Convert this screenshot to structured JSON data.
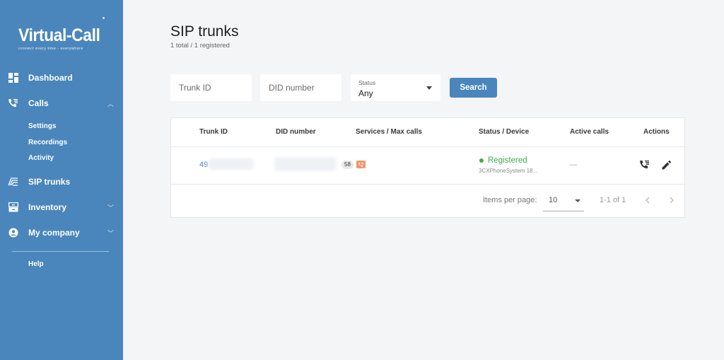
{
  "brand": {
    "name": "Virtual-Call",
    "tagline": "connect every time - everywhere"
  },
  "sidebar": {
    "items": [
      {
        "label": "Dashboard",
        "icon": "dashboard-icon"
      },
      {
        "label": "Calls",
        "icon": "phone-list-icon",
        "expanded": true,
        "children": [
          {
            "label": "Settings"
          },
          {
            "label": "Recordings"
          },
          {
            "label": "Activity"
          }
        ]
      },
      {
        "label": "SIP trunks",
        "icon": "sip-trunk-icon"
      },
      {
        "label": "Inventory",
        "icon": "inventory-icon"
      },
      {
        "label": "My company",
        "icon": "account-circle-icon"
      },
      {
        "label": "Help"
      }
    ]
  },
  "page": {
    "title": "SIP trunks",
    "subtitle": "1 total / 1 registered"
  },
  "filters": {
    "trunk_id_placeholder": "Trunk ID",
    "did_placeholder": "DID number",
    "status_label": "Status",
    "status_value": "Any",
    "search_label": "Search"
  },
  "table": {
    "headers": [
      "Trunk ID",
      "DID number",
      "Services / Max calls",
      "Status / Device",
      "Active calls",
      "Actions"
    ],
    "rows": [
      {
        "trunk_id": "49",
        "max_calls": "58",
        "status": "Registered",
        "device": "3CXPhoneSystem 18...",
        "active_calls": "—"
      }
    ]
  },
  "pagination": {
    "items_per_page_label": "Items per page:",
    "items_per_page_value": "10",
    "range": "1-1 of 1"
  },
  "colors": {
    "sidebar": "#4a86bc",
    "accent": "#4a86bc",
    "registered": "#3fae49",
    "service_badge": "#f0956a"
  }
}
